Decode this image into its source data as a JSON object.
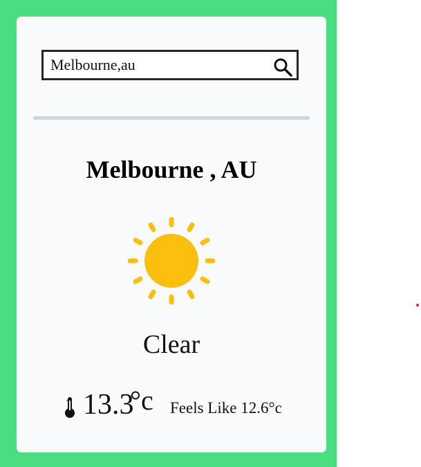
{
  "search": {
    "value": "Melbourne,au",
    "icon": "search-icon"
  },
  "weather": {
    "city": "Melbourne , AU",
    "condition": "Clear",
    "condition_icon": "sun-icon",
    "temperature": "13.3",
    "temperature_unit": "°c",
    "feels_like": "Feels Like 12.6°c",
    "thermometer_icon": "thermometer-icon"
  },
  "colors": {
    "background_panel": "#4ade80",
    "card": "#f8fafc",
    "sun": "#fbbf0f",
    "divider": "#d1d5db"
  }
}
